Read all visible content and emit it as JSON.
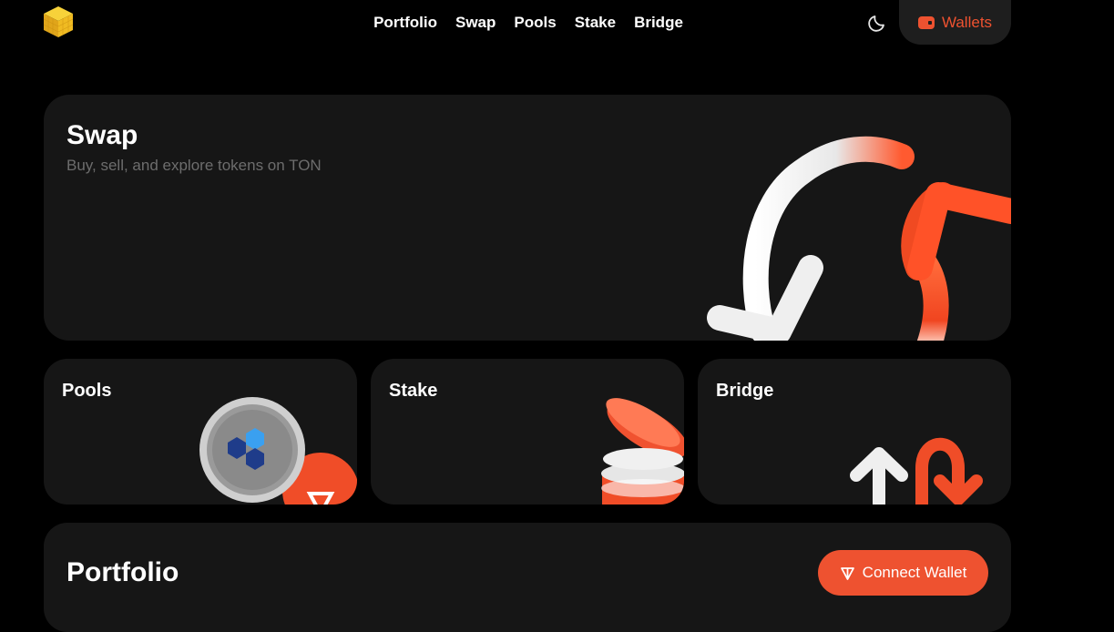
{
  "header": {
    "logo_icon": "cube-logo-icon",
    "nav": [
      {
        "label": "Portfolio"
      },
      {
        "label": "Swap"
      },
      {
        "label": "Pools"
      },
      {
        "label": "Stake"
      },
      {
        "label": "Bridge"
      }
    ],
    "theme_icon": "moon-icon",
    "wallets_label": "Wallets"
  },
  "swap": {
    "title": "Swap",
    "subtitle": "Buy, sell, and explore tokens on TON"
  },
  "cards": {
    "pools": "Pools",
    "stake": "Stake",
    "bridge": "Bridge"
  },
  "portfolio": {
    "title": "Portfolio",
    "connect_label": "Connect Wallet",
    "connect_icon": "ton-icon"
  },
  "colors": {
    "accent": "#ee5230",
    "background": "#000000",
    "card": "#161616",
    "muted_text": "#6d6d6d"
  }
}
